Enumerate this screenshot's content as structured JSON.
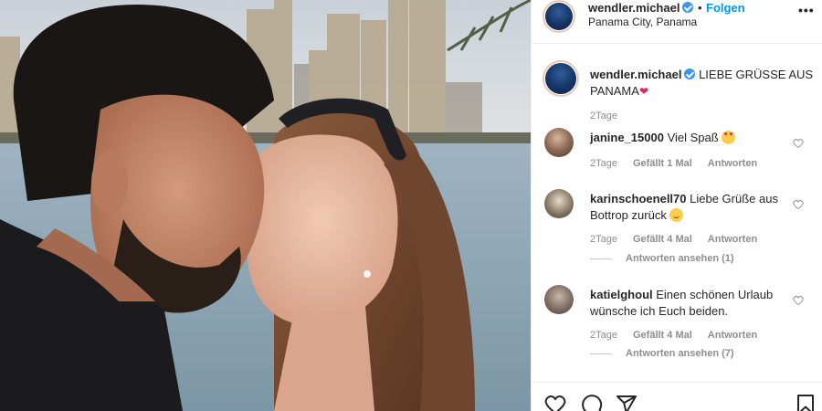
{
  "post": {
    "username": "wendler.michael",
    "follow_label": "Folgen",
    "dot": "•",
    "location": "Panama City, Panama",
    "more_label": "•••",
    "caption_text": "LIEBE GRÜSSE AUS PANAMA",
    "caption_emoji": "❤",
    "caption_time": "2Tage"
  },
  "comments": [
    {
      "username": "janine_15000",
      "text": "Viel Spaß",
      "emoji": "heart-eyes-emoji",
      "time": "2Tage",
      "likes": "Gefällt 1 Mal",
      "reply": "Antworten",
      "view_replies": ""
    },
    {
      "username": "karinschoenell70",
      "text": "Liebe Grüße aus Bottrop zurück",
      "emoji": "smile-emoji",
      "time": "2Tage",
      "likes": "Gefällt 4 Mal",
      "reply": "Antworten",
      "view_replies": "Antworten ansehen (1)"
    },
    {
      "username": "katielghoul",
      "text": "Einen schönen Urlaub wünsche ich Euch beiden.",
      "emoji": "",
      "time": "2Tage",
      "likes": "Gefällt 4 Mal",
      "reply": "Antworten",
      "view_replies": "Antworten ansehen (7)"
    }
  ],
  "colors": {
    "accent": "#0095f6",
    "verified": "#3897f0",
    "muted": "#8e8e8e",
    "text": "#262626"
  },
  "icons": [
    "heart-icon",
    "comment-icon",
    "share-icon",
    "bookmark-icon",
    "verified-badge-icon",
    "like-heart-icon"
  ]
}
